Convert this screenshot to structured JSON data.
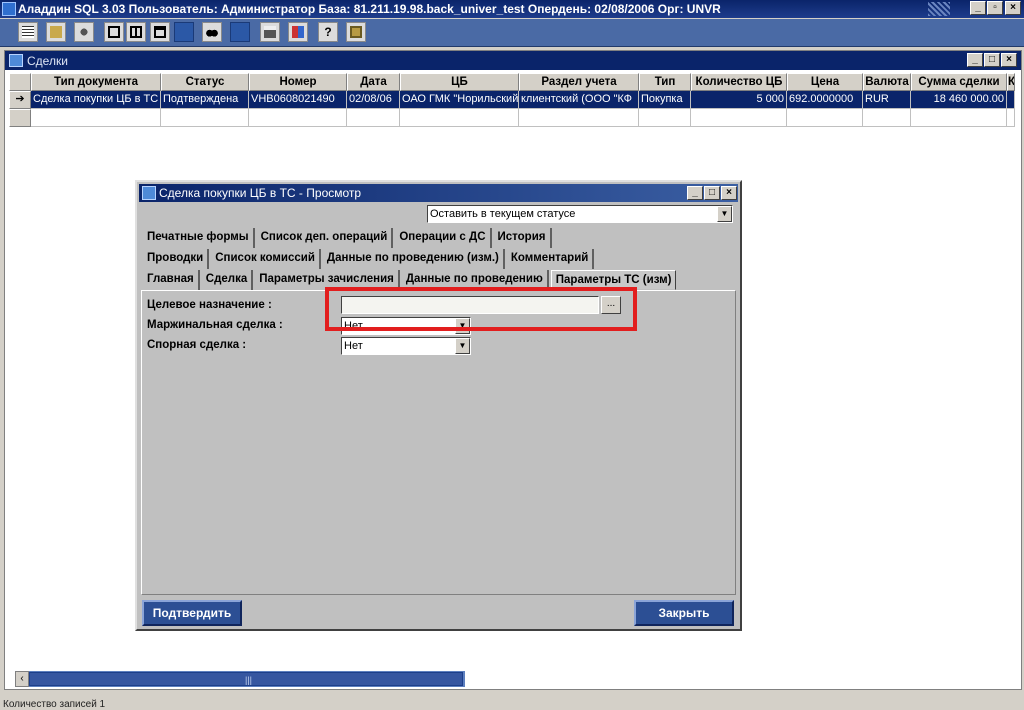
{
  "app": {
    "title": "Аладдин SQL 3.03 Пользователь: Администратор База: 81.211.19.98.back_univer_test Опердень: 02/08/2006 Орг: UNVR"
  },
  "toolbar": {
    "icons": [
      "report-icon",
      "filter-icon",
      "users-icon",
      "single-window-icon",
      "tile-icon",
      "cascade-icon",
      "blank-icon",
      "binoculars-icon",
      "blank-icon-2",
      "printer-icon",
      "tree-icon",
      "help-icon",
      "settings-icon"
    ]
  },
  "deals_window": {
    "title": "Сделки",
    "columns": [
      "Тип документа",
      "Статус",
      "Номер",
      "Дата",
      "ЦБ",
      "Раздел учета",
      "Тип",
      "Количество ЦБ",
      "Цена",
      "Валюта",
      "Сумма сделки",
      "К"
    ],
    "rows": [
      [
        "Сделка покупки ЦБ в ТС",
        "Подтверждена",
        "VHB0608021490",
        "02/08/06",
        "ОАО ГМК \"Норильский",
        "клиентский (ООО \"КФ",
        "Покупка",
        "5 000",
        "692.0000000",
        "RUR",
        "18 460 000.00",
        ""
      ]
    ],
    "record_count": "Количество записей 1"
  },
  "dialog": {
    "title": "Сделка покупки ЦБ в ТС - Просмотр",
    "status_action": "Оставить в текущем статусе",
    "tabs_row1": [
      "Печатные формы",
      "Список деп. операций",
      "Операции с ДС",
      "История"
    ],
    "tabs_row2": [
      "Проводки",
      "Список комиссий",
      "Данные по проведению (изм.)",
      "Комментарий"
    ],
    "tabs_row3": [
      "Главная",
      "Сделка",
      "Параметры зачисления",
      "Данные по проведению",
      "Параметры ТС (изм)"
    ],
    "fields": {
      "purpose_label": "Целевое назначение :",
      "purpose_value": "",
      "browse_label": "...",
      "margin_label": "Маржинальная сделка :",
      "margin_value": "Нет",
      "disputed_label": "Спорная сделка :",
      "disputed_value": "Нет"
    },
    "confirm_label": "Подтвердить",
    "close_label": "Закрыть"
  },
  "colors": {
    "titlebar": "#0a246a",
    "highlight": "#e21e1e",
    "dialog_bg": "#c0c0c0"
  }
}
